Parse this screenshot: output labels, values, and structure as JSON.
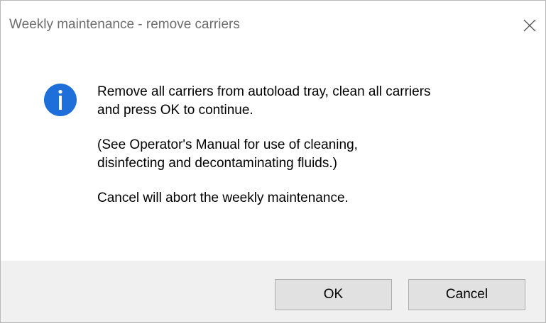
{
  "window": {
    "title": "Weekly maintenance - remove carriers",
    "close_icon": "close-icon"
  },
  "message": {
    "icon": "info-icon",
    "lines": [
      "Remove all carriers from autoload tray, clean all carriers",
      "and press OK to continue.",
      "(See Operator's Manual for use of cleaning,",
      "disinfecting and decontaminating fluids.)",
      "Cancel will abort the weekly maintenance."
    ]
  },
  "buttons": {
    "ok_label": "OK",
    "cancel_label": "Cancel"
  },
  "colors": {
    "info_blue": "#1e6fd9",
    "title_gray": "#6d6d6d",
    "footer_bg": "#f0f0f0",
    "button_bg": "#e1e1e1"
  }
}
